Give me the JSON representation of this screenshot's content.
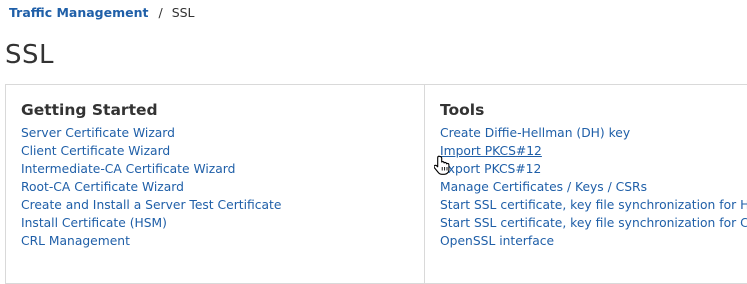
{
  "breadcrumb": {
    "parent": "Traffic Management",
    "separator": "/",
    "current": "SSL"
  },
  "page": {
    "title": "SSL"
  },
  "getting_started": {
    "heading": "Getting Started",
    "links": [
      "Server Certificate Wizard",
      "Client Certificate Wizard",
      "Intermediate-CA Certificate Wizard",
      "Root-CA Certificate Wizard",
      "Create and Install a Server Test Certificate",
      "Install Certificate (HSM)",
      "CRL Management"
    ]
  },
  "tools": {
    "heading": "Tools",
    "links": [
      "Create Diffie-Hellman (DH) key",
      "Import PKCS#12",
      "Export PKCS#12",
      "Manage Certificates / Keys / CSRs",
      "Start SSL certificate, key file synchronization for HA",
      "Start SSL certificate, key file synchronization for Cluster",
      "OpenSSL interface"
    ]
  },
  "colors": {
    "link": "#1f5fa8",
    "text": "#333333",
    "border": "#d9d9d9"
  },
  "icons": {
    "cursor": "hand-pointer-icon"
  }
}
